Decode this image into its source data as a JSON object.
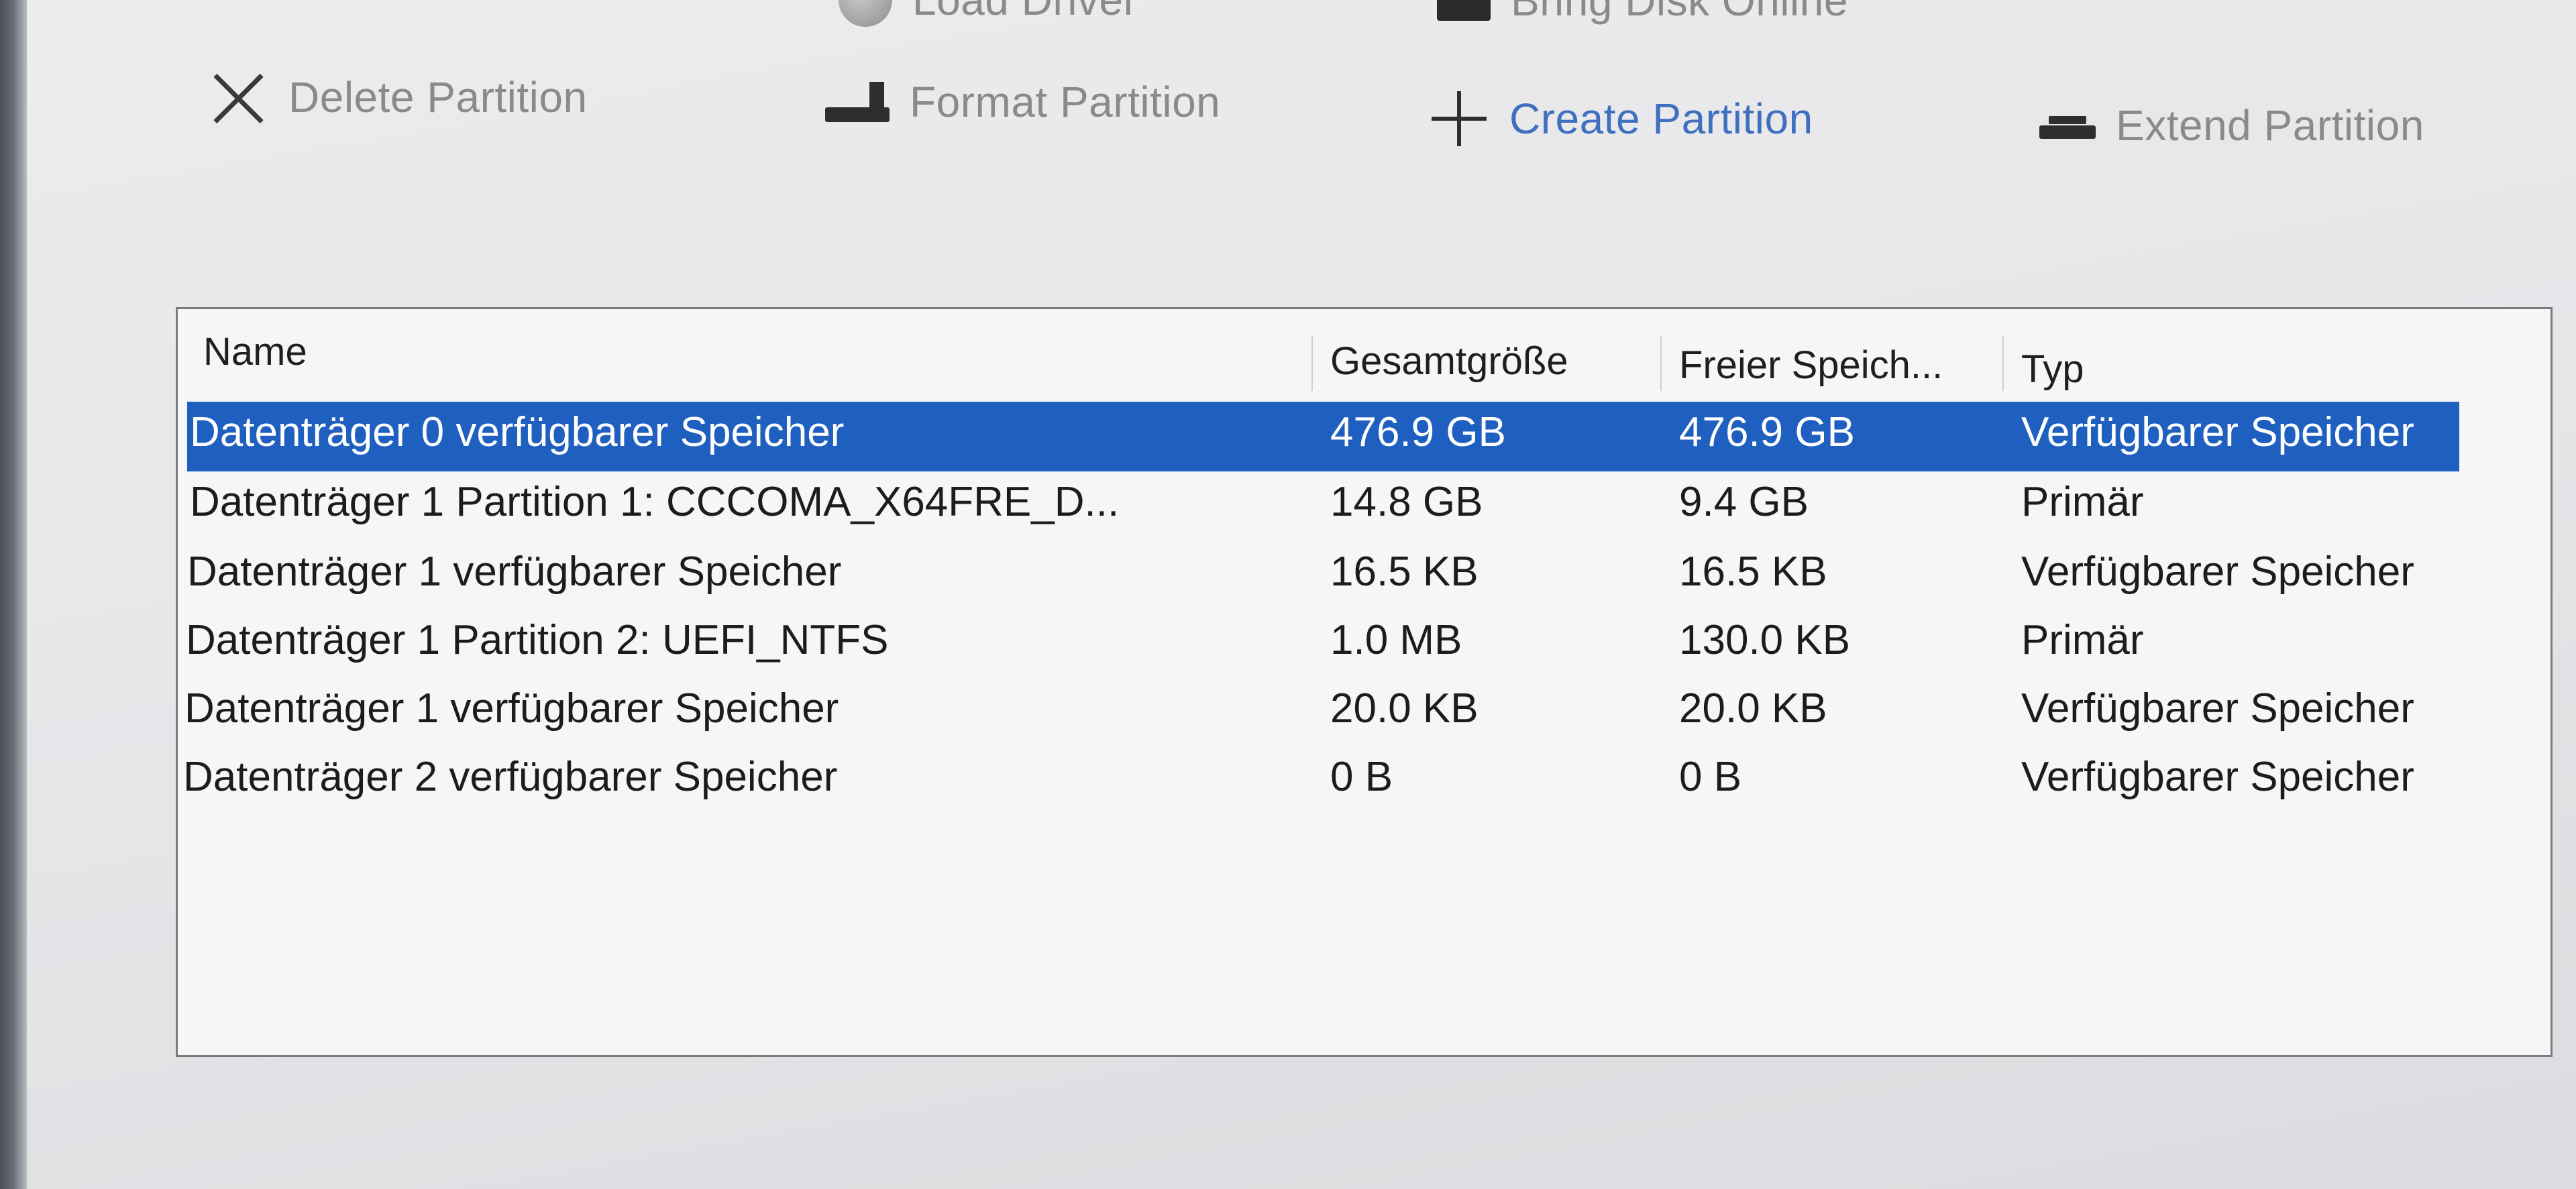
{
  "toolbar": {
    "top_row": [
      {
        "label": "Load Driver",
        "icon": "driver-disc-icon"
      },
      {
        "label": "Bring Disk Online",
        "icon": "disk-online-icon"
      }
    ],
    "actions": [
      {
        "key": "delete",
        "label": "Delete Partition",
        "icon": "close-icon",
        "enabled": false
      },
      {
        "key": "format",
        "label": "Format Partition",
        "icon": "format-drive-icon",
        "enabled": false
      },
      {
        "key": "create",
        "label": "Create Partition",
        "icon": "plus-icon",
        "enabled": true
      },
      {
        "key": "extend",
        "label": "Extend Partition",
        "icon": "extend-drive-icon",
        "enabled": false
      }
    ]
  },
  "table": {
    "columns": [
      "Name",
      "Gesamtgröße",
      "Freier Speich...",
      "Typ"
    ],
    "rows": [
      {
        "name": "Datenträger 0 verfügbarer Speicher",
        "size": "476.9 GB",
        "free": "476.9 GB",
        "type": "Verfügbarer Speicher",
        "selected": true
      },
      {
        "name": "Datenträger 1 Partition 1: CCCOMA_X64FRE_D...",
        "size": "14.8 GB",
        "free": "9.4 GB",
        "type": "Primär",
        "selected": false
      },
      {
        "name": "Datenträger 1 verfügbarer Speicher",
        "size": "16.5 KB",
        "free": "16.5 KB",
        "type": "Verfügbarer Speicher",
        "selected": false
      },
      {
        "name": "Datenträger 1 Partition 2: UEFI_NTFS",
        "size": "1.0 MB",
        "free": "130.0 KB",
        "type": "Primär",
        "selected": false
      },
      {
        "name": "Datenträger 1 verfügbarer Speicher",
        "size": "20.0 KB",
        "free": "20.0 KB",
        "type": "Verfügbarer Speicher",
        "selected": false
      },
      {
        "name": "Datenträger 2 verfügbarer Speicher",
        "size": "0 B",
        "free": "0 B",
        "type": "Verfügbarer Speicher",
        "selected": false
      }
    ]
  },
  "colors": {
    "selection": "#1e5fbf",
    "link": "#3f6fbf",
    "disabled_text": "#8a8a8a"
  }
}
